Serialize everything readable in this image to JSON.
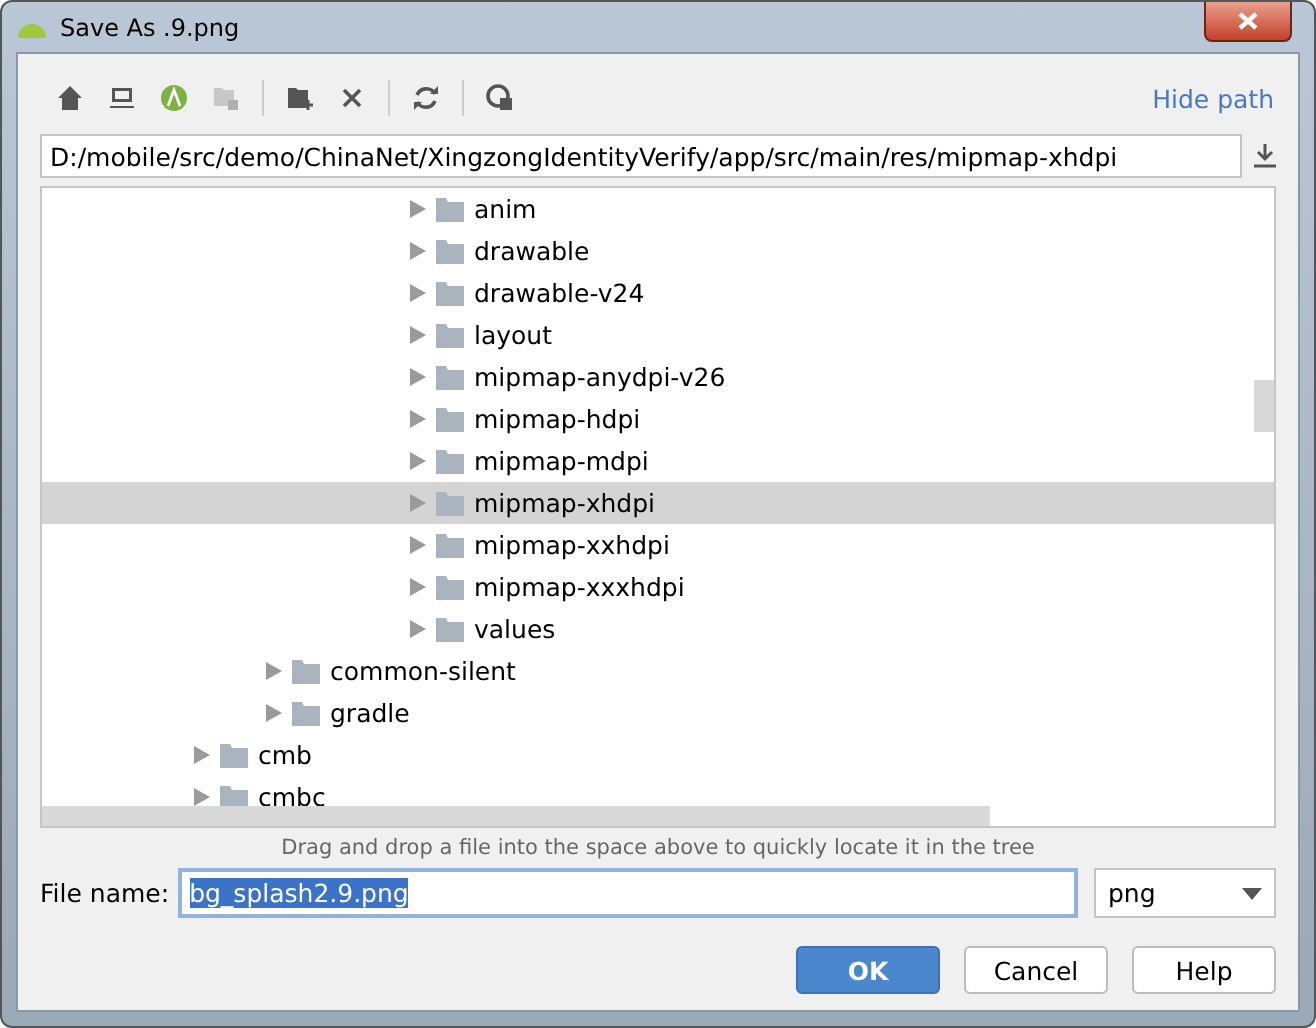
{
  "window": {
    "title": "Save As .9.png"
  },
  "toolbar": {
    "link": "Hide path"
  },
  "path": {
    "value": "D:/mobile/src/demo/ChinaNet/XingzongIdentityVerify/app/src/main/res/mipmap-xhdpi"
  },
  "tree": [
    {
      "children": [
        {
          "children": [
            {
              "children": [
                {
                  "label": "anim",
                  "selected": false
                },
                {
                  "label": "drawable",
                  "selected": false
                },
                {
                  "label": "drawable-v24",
                  "selected": false
                },
                {
                  "label": "layout",
                  "selected": false
                },
                {
                  "label": "mipmap-anydpi-v26",
                  "selected": false
                },
                {
                  "label": "mipmap-hdpi",
                  "selected": false
                },
                {
                  "label": "mipmap-mdpi",
                  "selected": false
                },
                {
                  "label": "mipmap-xhdpi",
                  "selected": true
                },
                {
                  "label": "mipmap-xxhdpi",
                  "selected": false
                },
                {
                  "label": "mipmap-xxxhdpi",
                  "selected": false
                },
                {
                  "label": "values",
                  "selected": false
                }
              ]
            }
          ]
        },
        {
          "label": "common-silent",
          "selected": false
        },
        {
          "label": "gradle",
          "selected": false
        }
      ]
    },
    {
      "label": "cmb",
      "selected": false
    },
    {
      "label": "cmbc",
      "selected": false
    }
  ],
  "hint": "Drag and drop a file into the space above to quickly locate it in the tree",
  "file_name": {
    "label": "File name:",
    "value": "bg_splash2.9.png"
  },
  "file_type": {
    "value": "png"
  },
  "buttons": [
    {
      "label": "OK",
      "kind": "primary"
    },
    {
      "label": "Cancel",
      "kind": "normal"
    },
    {
      "label": "Help",
      "kind": "normal"
    }
  ]
}
